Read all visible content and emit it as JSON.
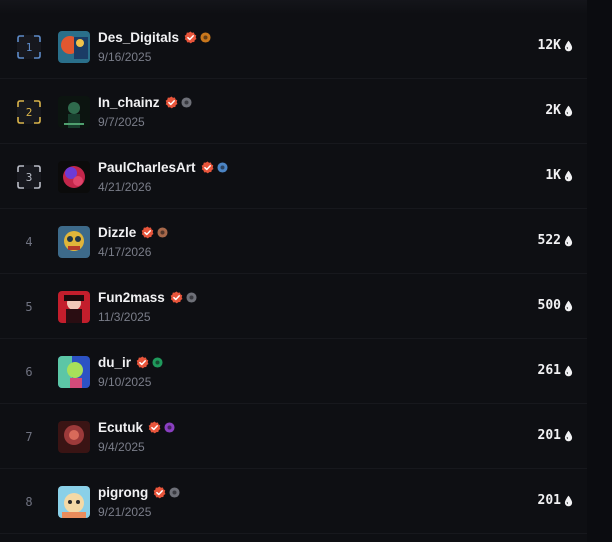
{
  "rows": [
    {
      "rank": "1",
      "name": "Des_Digitals",
      "date": "9/16/2025",
      "value": "12K",
      "badge_color": "#c9771c",
      "frame": "#5d8ac7"
    },
    {
      "rank": "2",
      "name": "In_chainz",
      "date": "9/7/2025",
      "value": "2K",
      "badge_color": "#6e7078",
      "frame": "#d9b34a"
    },
    {
      "rank": "3",
      "name": "PaulCharlesArt",
      "date": "4/21/2026",
      "value": "1K",
      "badge_color": "#4b84c4",
      "frame": "#b9bcc6"
    },
    {
      "rank": "4",
      "name": "Dizzle",
      "date": "4/17/2026",
      "value": "522",
      "badge_color": "#a7684a",
      "frame": ""
    },
    {
      "rank": "5",
      "name": "Fun2mass",
      "date": "11/3/2025",
      "value": "500",
      "badge_color": "#6e7078",
      "frame": ""
    },
    {
      "rank": "6",
      "name": "du_ir",
      "date": "9/10/2025",
      "value": "261",
      "badge_color": "#1f9a5c",
      "frame": ""
    },
    {
      "rank": "7",
      "name": "Ecutuk",
      "date": "9/4/2025",
      "value": "201",
      "badge_color": "#8a3fc1",
      "frame": ""
    },
    {
      "rank": "8",
      "name": "pigrong",
      "date": "9/21/2025",
      "value": "201",
      "badge_color": "#6e7078",
      "frame": ""
    }
  ],
  "icons": {
    "verified": "verified-badge-icon",
    "drop": "drop-icon"
  },
  "colors": {
    "verified": "#e8553b",
    "background": "#0e0f13"
  }
}
